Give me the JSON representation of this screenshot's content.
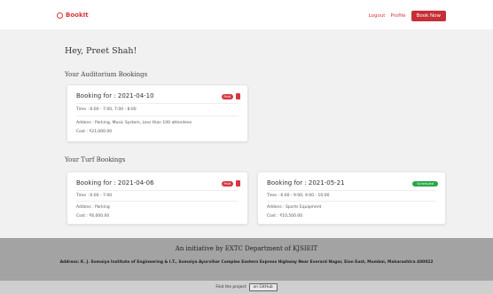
{
  "navbar": {
    "brand": "BookIt",
    "logout": "Logout",
    "profile": "Profile",
    "book_now": "Book Now"
  },
  "greeting": "Hey, Preet Shah!",
  "auditorium": {
    "title": "Your Auditorium Bookings",
    "bookings": [
      {
        "title": "Booking for : 2021-04-10",
        "time": "Time : 6:00 - 7:00, 7:00 - 8:00",
        "addons": "Addons : Parking, Music System, Less than 100 attendees",
        "cost": "Cost : ₹21,000.00",
        "badge": "Paid"
      }
    ]
  },
  "turf": {
    "title": "Your Turf Bookings",
    "bookings": [
      {
        "title": "Booking for : 2021-04-06",
        "time": "Time : 6:00 - 7:00",
        "addons": "Addons : Parking",
        "cost": "Cost : ₹6,000.00",
        "badge": "Paid"
      },
      {
        "title": "Booking for : 2021-05-21",
        "time": "Time : 6:00 - 9:00, 9:00 - 10:00",
        "addons": "Addons : Sports Equipment",
        "cost": "Cost : ₹10,500.00",
        "badge": "Scheduled"
      }
    ]
  },
  "footer": {
    "title": "An initiative by EXTC Department of KJSIEIT",
    "address": "Address: K. J. Somaiya Institute of Engineering & I.T., Somaiya Ayurvihar Complex Eastern Express Highway Near Everard Nagar, Sion East, Mumbai, Maharashtra 400022",
    "find_project": "Find the project",
    "github": "on GitHub"
  },
  "colors": {
    "accent": "#d9363e",
    "scheduled": "#28a745",
    "footer_bg": "#a3a3a3"
  },
  "icons": {
    "brand": "logo-circle-icon",
    "delete": "trash-icon"
  }
}
